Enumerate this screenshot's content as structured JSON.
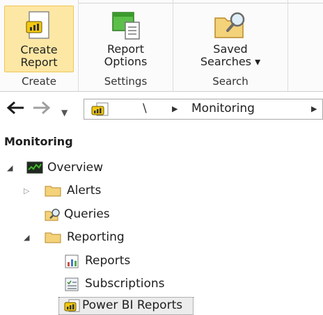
{
  "ribbon": {
    "groups": [
      {
        "name": "Create",
        "button": "Create\nReport"
      },
      {
        "name": "Settings",
        "button": "Report\nOptions"
      },
      {
        "name": "Search",
        "button": "Saved\nSearches ▾"
      }
    ]
  },
  "address": {
    "root_sep": "\\",
    "crumb": "Monitoring"
  },
  "tree": {
    "title": "Monitoring",
    "items": [
      {
        "label": "Overview"
      },
      {
        "label": "Alerts"
      },
      {
        "label": "Queries"
      },
      {
        "label": "Reporting"
      },
      {
        "label": "Reports"
      },
      {
        "label": "Subscriptions"
      },
      {
        "label": "Power BI Reports"
      }
    ]
  },
  "colors": {
    "selected_button_bg": "#fde7a4",
    "selected_button_border": "#f0c654",
    "folder": "#f3d27a",
    "overview_green": "#3fb52a"
  }
}
